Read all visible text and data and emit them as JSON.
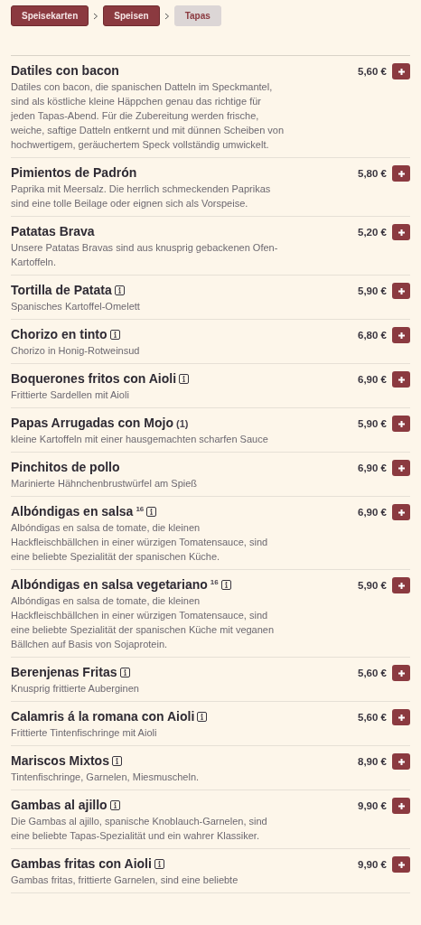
{
  "breadcrumb": [
    {
      "label": "Speisekarten",
      "selected": false
    },
    {
      "label": "Speisen",
      "selected": false
    },
    {
      "label": "Tapas",
      "selected": true
    }
  ],
  "items": [
    {
      "name": "Datiles con bacon",
      "info": false,
      "price": "5,60 €",
      "description": "Datiles con bacon, die spanischen Datteln im Speckmantel, sind als köstliche kleine Häppchen genau das richtige für jeden Tapas-Abend. Für die Zubereitung werden frische, weiche, saftige Datteln entkernt und mit dünnen Scheiben von hochwertigem, geräuchertem Speck vollständig umwickelt."
    },
    {
      "name": "Pimientos de Padrón",
      "info": false,
      "price": "5,80 €",
      "description": "Paprika mit Meersalz. Die herrlich schmeckenden Paprikas sind eine tolle Beilage oder eignen sich als Vorspeise."
    },
    {
      "name": "Patatas Brava",
      "info": false,
      "price": "5,20 €",
      "description": "Unsere Patatas Bravas sind aus knusprig gebackenen Ofen-Kartoffeln."
    },
    {
      "name": "Tortilla de Patata",
      "info": true,
      "price": "5,90 €",
      "description": "Spanisches Kartoffel-Omelett"
    },
    {
      "name": "Chorizo en tinto",
      "info": true,
      "price": "6,80 €",
      "description": "Chorizo in Honig-Rotweinsud"
    },
    {
      "name": "Boquerones fritos con Aioli",
      "info": true,
      "price": "6,90 €",
      "description": "Frittierte Sardellen mit Aioli"
    },
    {
      "name": "Papas Arrugadas con Mojo",
      "note": "(1)",
      "info": false,
      "price": "5,90 €",
      "description": "kleine Kartoffeln mit einer hausgemachten scharfen Sauce"
    },
    {
      "name": "Pinchitos de pollo",
      "info": false,
      "price": "6,90 €",
      "description": "Marinierte Hähnchenbrustwürfel am Spieß"
    },
    {
      "name": "Albóndigas en salsa",
      "superscript": "16",
      "info": true,
      "price": "6,90 €",
      "description": "Albóndigas en salsa de tomate, die kleinen Hackfleischbällchen in einer würzigen Tomatensauce, sind eine beliebte Spezialität der spanischen Küche."
    },
    {
      "name": "Albóndigas en salsa vegetariano",
      "superscript": "16",
      "info": true,
      "price": "5,90 €",
      "description": "Albóndigas en salsa de tomate, die kleinen Hackfleischbällchen in einer würzigen Tomatensauce, sind eine beliebte Spezialität der spanischen Küche mit veganen Bällchen auf Basis von Sojaprotein."
    },
    {
      "name": "Berenjenas Fritas",
      "info": true,
      "price": "5,60 €",
      "description": "Knusprig frittierte Auberginen"
    },
    {
      "name": "Calamris á la romana con Aioli",
      "info": true,
      "price": "5,60 €",
      "description": "Frittierte Tintenfischringe mit Aioli"
    },
    {
      "name": "Mariscos Mixtos",
      "info": true,
      "price": "8,90 €",
      "description": "Tintenfischringe, Garnelen, Miesmuscheln."
    },
    {
      "name": "Gambas al ajillo",
      "info": true,
      "price": "9,90 €",
      "description": "Die Gambas al ajillo, spanische Knoblauch-Garnelen, sind eine beliebte Tapas-Spezialität und ein wahrer Klassiker."
    },
    {
      "name": "Gambas fritas con Aioli",
      "info": true,
      "price": "9,90 €",
      "description": "Gambas fritas, frittierte Garnelen, sind eine beliebte"
    }
  ]
}
